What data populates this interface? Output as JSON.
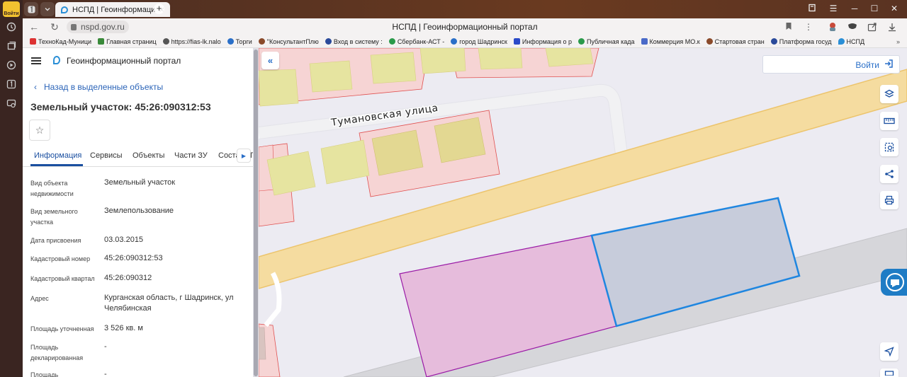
{
  "browser": {
    "rail_badge": "Войти",
    "tab_title": "НСПД | Геоинформаци",
    "url": "nspd.gov.ru",
    "page_title": "НСПД | Геоинформационный портал",
    "pinned_tab_label": "1",
    "bookmarks": [
      {
        "label": "ТехноКад-Муници",
        "color": "#d33"
      },
      {
        "label": "Главная страниц",
        "color": "#3a8a3a"
      },
      {
        "label": "https://fias-lk.nalo",
        "color": "#555"
      },
      {
        "label": "Торги",
        "color": "#2a6fc8"
      },
      {
        "label": "\"КонсультантПлю",
        "color": "#8a4a2a"
      },
      {
        "label": "Вход в систему :",
        "color": "#2a4a9a"
      },
      {
        "label": "Сбербанк-АСТ -",
        "color": "#2a9a4a"
      },
      {
        "label": "город Шадринск",
        "color": "#2a6fc8"
      },
      {
        "label": "Информация о р",
        "color": "#2a4ac8"
      },
      {
        "label": "Публичная када",
        "color": "#2a9a4a"
      },
      {
        "label": "Коммерция МО.к",
        "color": "#4a6ac8"
      },
      {
        "label": "Стартовая стран",
        "color": "#8a4a2a"
      },
      {
        "label": "Платформа госуд",
        "color": "#2a4a9a"
      },
      {
        "label": "НСПД",
        "color": "#2a8fd6"
      }
    ]
  },
  "panel": {
    "brand": "Геоинформационный портал",
    "back_link": "Назад в выделенные объекты",
    "title": "Земельный участок: 45:26:090312:53",
    "tabs": [
      "Информация",
      "Сервисы",
      "Объекты",
      "Части ЗУ",
      "Соста"
    ],
    "tabs_overflow": "П",
    "attributes": [
      {
        "label": "Вид объекта недвижимости",
        "value": "Земельный участок"
      },
      {
        "label": "Вид земельного участка",
        "value": "Землепользование"
      },
      {
        "label": "Дата присвоения",
        "value": "03.03.2015"
      },
      {
        "label": "Кадастровый номер",
        "value": "45:26:090312:53"
      },
      {
        "label": "Кадастровый квартал",
        "value": "45:26:090312"
      },
      {
        "label": "Адрес",
        "value": "Курганская область, г Шадринск, ул Челябинская"
      },
      {
        "label": "Площадь уточненная",
        "value": "3 526 кв. м"
      },
      {
        "label": "Площадь декларированная",
        "value": "-"
      },
      {
        "label": "Площадь",
        "value": "-"
      }
    ]
  },
  "map": {
    "street_label": "Тумановская  улица",
    "login_label": "Войти",
    "colors": {
      "background": "#ecebf2",
      "road": "#f5dca0",
      "road_edge": "#ecc46c",
      "building": "#e6e4a0",
      "parcel_fill": "#f6d4d4",
      "parcel_edge": "#e05050",
      "selected_fill": "#c7ccdb",
      "selected_edge": "#1f86e0",
      "neighbor_fill": "#e6bcdc",
      "neighbor_edge": "#9a1aa6",
      "sidewalk": "#d6d6da"
    }
  }
}
